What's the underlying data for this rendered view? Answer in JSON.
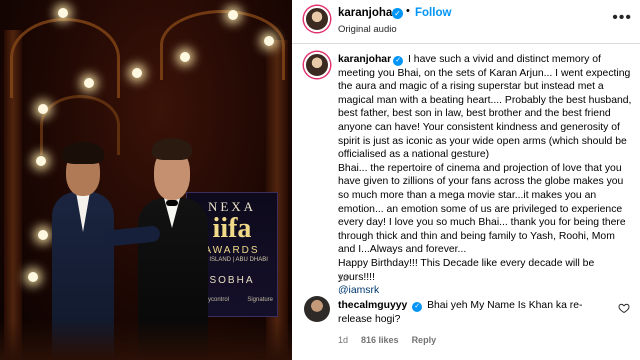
{
  "media": {
    "logo": {
      "nexa": "NEXA",
      "iifa": "iifa",
      "awards": "AWARDS",
      "location": "YAS ISLAND | ABU DHABI",
      "sponsor_main": "SOBHA",
      "sponsor_left": "moneycontrol",
      "sponsor_right": "Signature"
    }
  },
  "header": {
    "username": "karanjohar",
    "separator": "•",
    "follow_label": "Follow",
    "audio_label": "Original audio",
    "more_icon": "more-icon"
  },
  "caption": {
    "username": "karanjohar",
    "paragraph_1": "I have such a vivid and distinct memory of meeting you Bhai, on the sets of Karan Arjun... I went expecting the aura and magic of a rising superstar but instead met a magical man with a beating heart.... Probably the best husband, best father, best son in law, best brother and the best friend anyone can have! Your consistent kindness and generosity of spirit is just as iconic as your wide open arms (which should be officialised as a national gesture)",
    "paragraph_2": "Bhai... the repertoire of cinema and projection of love that you have given to zillions of your fans across the globe makes you so much more than a mega movie star...it makes you an emotion... an emotion some of us are privileged to experience every day! I love you so much Bhai... thank you for being there through thick and thin and being family to Yash, Roohi, Mom and I...Always and forever...",
    "paragraph_3": "Happy Birthday!!! This Decade like every decade will be yours!!!!",
    "mention": "@iamsrk",
    "time": "1d"
  },
  "comment": {
    "username": "thecalmguyyy",
    "text": "Bhai yeh My Name Is Khan ka re-release hogi?",
    "time": "1d",
    "likes": "816 likes",
    "reply_label": "Reply"
  },
  "colors": {
    "accent": "#0095f6",
    "mention": "#00376b",
    "muted": "#737373"
  }
}
